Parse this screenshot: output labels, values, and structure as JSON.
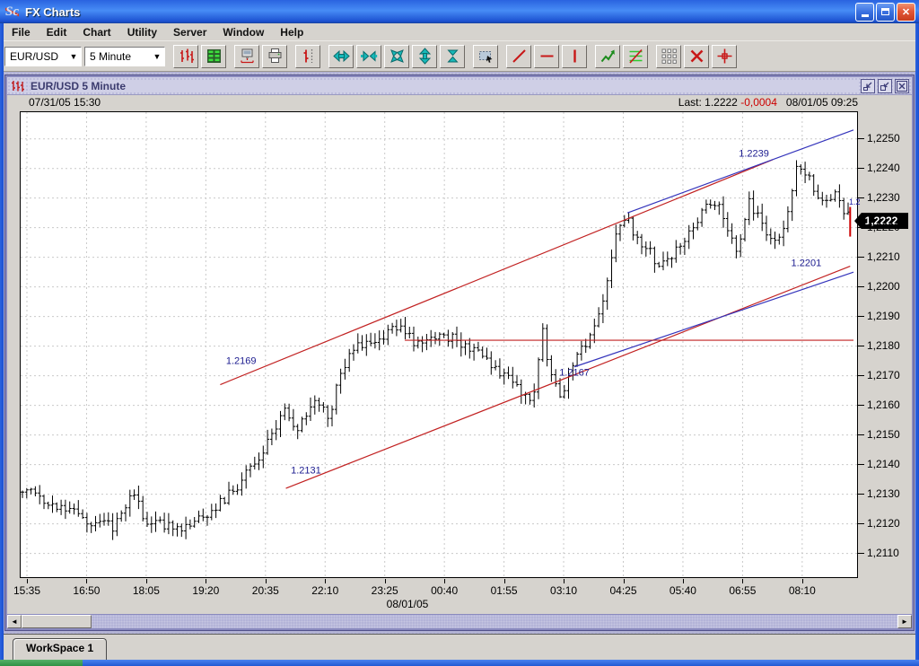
{
  "app": {
    "title": "FX Charts",
    "logo_text": "Sc"
  },
  "window_buttons": {
    "minimize": "minimize",
    "restore": "restore",
    "close": "close"
  },
  "menu_items": [
    "File",
    "Edit",
    "Chart",
    "Utility",
    "Server",
    "Window",
    "Help"
  ],
  "toolbar": {
    "symbol": "EUR/USD",
    "interval": "5 Minute",
    "icons": [
      "ohlc-bars",
      "quote-list",
      "server-link",
      "printer",
      "single-bar",
      "expand-horizontal",
      "compress-horizontal",
      "fit-screen",
      "expand-vertical",
      "compress-vertical",
      "zoom-box",
      "trend-line",
      "horizontal-line",
      "vertical-line",
      "zigzag-indicator",
      "fib-lines",
      "grid",
      "delete-line",
      "crosshair"
    ]
  },
  "child_window": {
    "title": "EUR/USD 5 Minute"
  },
  "status": {
    "left_datetime": "07/31/05 15:30",
    "last_label": "Last:",
    "last_value": "1.2222",
    "change": "-0,0004",
    "right_datetime": "08/01/05 09:25"
  },
  "price_tag": "1,2222",
  "axis_partial_label": "1.2",
  "workspace_tab": "WorkSpace 1",
  "chart_data": {
    "type": "ohlc-bars",
    "symbol": "EUR/USD",
    "interval": "5 Minute",
    "title": "EUR/USD 5 Minute",
    "last_price": 1.2222,
    "change": -0.0004,
    "ylim": [
      1.2102,
      1.2259
    ],
    "grid": "dashed",
    "bar_color": "#000000",
    "y_ticks": [
      {
        "v": 1.225,
        "label": "1,2250"
      },
      {
        "v": 1.224,
        "label": "1,2240"
      },
      {
        "v": 1.223,
        "label": "1,2230"
      },
      {
        "v": 1.222,
        "label": "1,2220"
      },
      {
        "v": 1.221,
        "label": "1,2210"
      },
      {
        "v": 1.22,
        "label": "1,2200"
      },
      {
        "v": 1.219,
        "label": "1,2190"
      },
      {
        "v": 1.218,
        "label": "1,2180"
      },
      {
        "v": 1.217,
        "label": "1,2170"
      },
      {
        "v": 1.216,
        "label": "1,2160"
      },
      {
        "v": 1.215,
        "label": "1,2150"
      },
      {
        "v": 1.214,
        "label": "1,2140"
      },
      {
        "v": 1.213,
        "label": "1,2130"
      },
      {
        "v": 1.212,
        "label": "1,2120"
      },
      {
        "v": 1.211,
        "label": "1,2110"
      }
    ],
    "x_tick_labels": [
      "15:35",
      "16:50",
      "18:05",
      "19:20",
      "20:35",
      "22:10",
      "23:25",
      "00:40",
      "01:55",
      "03:10",
      "04:25",
      "05:40",
      "06:55",
      "08:10"
    ],
    "x_date_label": "08/01/05",
    "bar_count": 193,
    "price_path_anchors": [
      [
        0.0,
        1.2132
      ],
      [
        0.039,
        1.2127
      ],
      [
        0.077,
        1.2121
      ],
      [
        0.109,
        1.2119
      ],
      [
        0.134,
        1.213
      ],
      [
        0.152,
        1.212
      ],
      [
        0.2,
        1.2119
      ],
      [
        0.227,
        1.2124
      ],
      [
        0.257,
        1.2132
      ],
      [
        0.289,
        1.2143
      ],
      [
        0.317,
        1.2158
      ],
      [
        0.332,
        1.215
      ],
      [
        0.353,
        1.2163
      ],
      [
        0.371,
        1.2156
      ],
      [
        0.386,
        1.2172
      ],
      [
        0.405,
        1.218
      ],
      [
        0.432,
        1.2183
      ],
      [
        0.454,
        1.2187
      ],
      [
        0.481,
        1.218
      ],
      [
        0.508,
        1.2184
      ],
      [
        0.534,
        1.2181
      ],
      [
        0.561,
        1.2175
      ],
      [
        0.583,
        1.217
      ],
      [
        0.599,
        1.2166
      ],
      [
        0.619,
        1.2162
      ],
      [
        0.629,
        1.2186
      ],
      [
        0.64,
        1.217
      ],
      [
        0.651,
        1.2163
      ],
      [
        0.669,
        1.2175
      ],
      [
        0.688,
        1.2184
      ],
      [
        0.705,
        1.2196
      ],
      [
        0.72,
        1.2221
      ],
      [
        0.734,
        1.2223
      ],
      [
        0.745,
        1.2215
      ],
      [
        0.759,
        1.2213
      ],
      [
        0.772,
        1.2206
      ],
      [
        0.788,
        1.2211
      ],
      [
        0.802,
        1.2216
      ],
      [
        0.815,
        1.2222
      ],
      [
        0.831,
        1.2229
      ],
      [
        0.847,
        1.2226
      ],
      [
        0.865,
        1.221
      ],
      [
        0.879,
        1.2229
      ],
      [
        0.896,
        1.2222
      ],
      [
        0.91,
        1.2214
      ],
      [
        0.922,
        1.2221
      ],
      [
        0.939,
        1.2241
      ],
      [
        0.955,
        1.2236
      ],
      [
        0.968,
        1.2228
      ],
      [
        0.982,
        1.2232
      ],
      [
        0.996,
        1.2224
      ]
    ],
    "trend_lines": [
      {
        "name": "support-long",
        "color": "#c22222",
        "x1": 0.317,
        "p1": 1.2132,
        "x2": 0.996,
        "p2": 1.2207,
        "labels": [
          {
            "text": "1.2131",
            "x": 0.323,
            "p": 1.2137
          },
          {
            "text": "1.2167",
            "x": 0.646,
            "p": 1.217
          }
        ]
      },
      {
        "name": "resistance-red",
        "color": "#c22222",
        "x1": 0.238,
        "p1": 1.2167,
        "x2": 0.903,
        "p2": 1.2243,
        "labels": [
          {
            "text": "1.2169",
            "x": 0.245,
            "p": 1.2174
          }
        ]
      },
      {
        "name": "upper-blue",
        "color": "#3333bb",
        "x1": 0.728,
        "p1": 1.2225,
        "x2": 1.0,
        "p2": 1.2253,
        "labels": [
          {
            "text": "1.2239",
            "x": 0.862,
            "p": 1.2244
          }
        ]
      },
      {
        "name": "lower-blue",
        "color": "#3333bb",
        "x1": 0.664,
        "p1": 1.2173,
        "x2": 1.0,
        "p2": 1.2205,
        "labels": [
          {
            "text": "1.2201",
            "x": 0.925,
            "p": 1.2207
          }
        ]
      }
    ],
    "horizontal_line": {
      "color": "#c22222",
      "price": 1.2182,
      "x1": 0.46,
      "x2": 1.0
    },
    "last_marker": {
      "color": "#cc0000",
      "x": 0.996,
      "p1": 1.2227,
      "p2": 1.2217
    }
  }
}
